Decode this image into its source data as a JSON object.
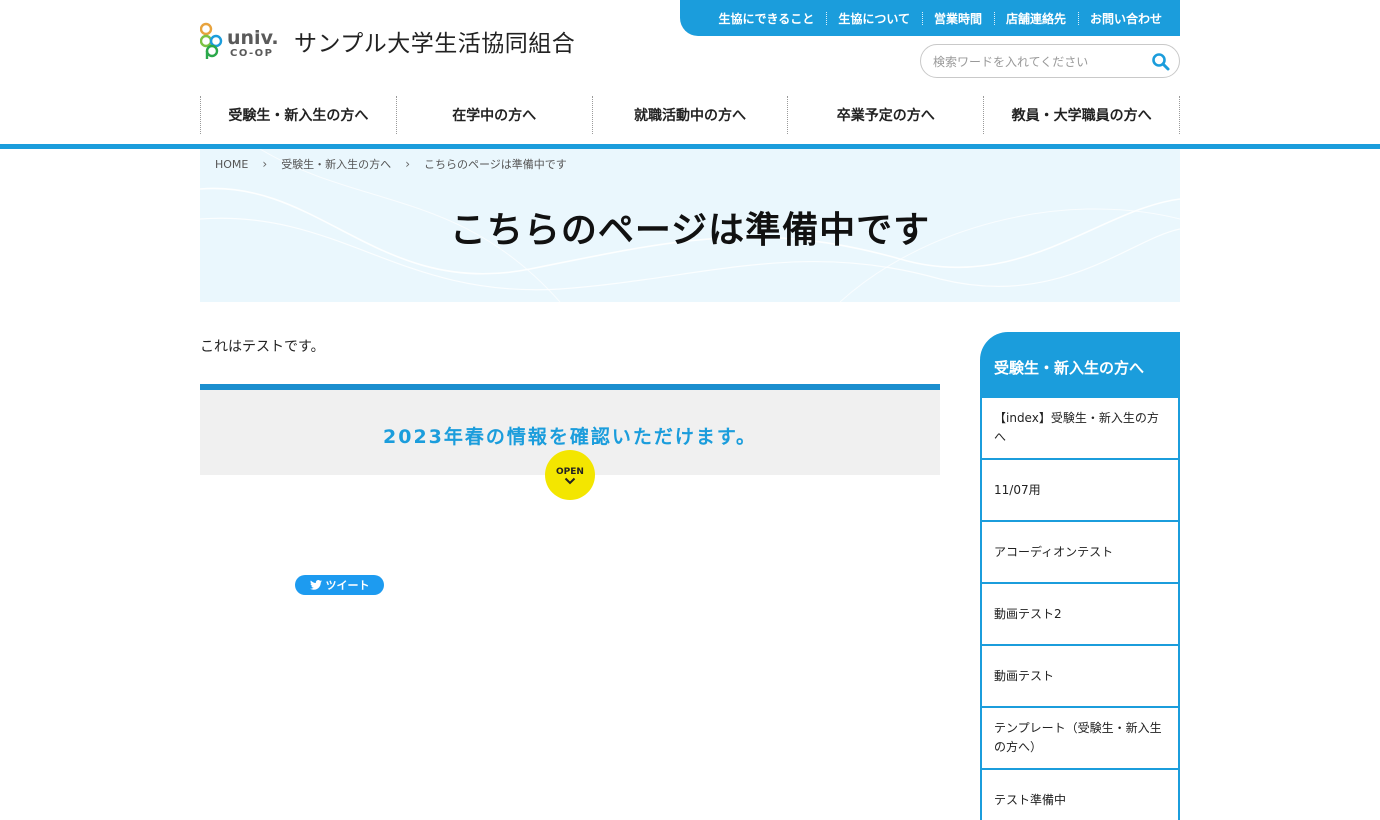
{
  "header": {
    "logo_text": "UNIV. CO-OP",
    "site_title": "サンプル大学生活協同組合",
    "util_nav": [
      "生協にできること",
      "生協について",
      "営業時間",
      "店舗連絡先",
      "お問い合わせ"
    ],
    "search": {
      "placeholder": "検索ワードを入れてください",
      "value": ""
    },
    "main_nav": [
      "受験生・新入生の方へ",
      "在学中の方へ",
      "就職活動中の方へ",
      "卒業予定の方へ",
      "教員・大学職員の方へ"
    ]
  },
  "hero": {
    "breadcrumb": [
      "HOME",
      "受験生・新入生の方へ",
      "こちらのページは準備中です"
    ],
    "title": "こちらのページは準備中です"
  },
  "content": {
    "intro": "これはテストです。",
    "accordion_title": "2023年春の情報を確認いただけます。",
    "open_label": "OPEN",
    "tweet_label": "ツイート"
  },
  "sidebar": {
    "heading": "受験生・新入生の方へ",
    "items": [
      "【index】受験生・新入生の方へ",
      "11/07用",
      "アコーディオンテスト",
      "動画テスト2",
      "動画テスト",
      "テンプレート（受験生・新入生の方へ）",
      "テスト準備中"
    ]
  },
  "colors": {
    "accent_blue": "#1b9ddc",
    "hero_bg": "#eaf7fd",
    "open_yellow": "#f3e600",
    "twitter_blue": "#1d9bf0"
  }
}
